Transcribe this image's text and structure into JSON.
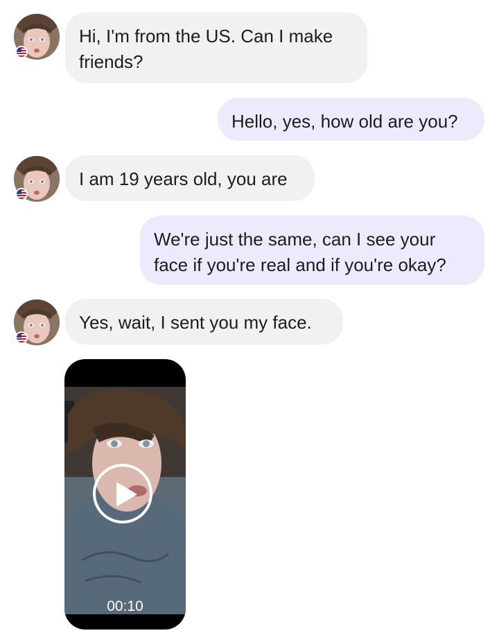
{
  "conversation": {
    "contact_country_flag": "us-flag-icon",
    "messages": [
      {
        "direction": "incoming",
        "text": "Hi, I'm from the US. Can I make friends?"
      },
      {
        "direction": "outgoing",
        "text": "Hello, yes, how old are you?"
      },
      {
        "direction": "incoming",
        "text": "I am 19 years old, you are"
      },
      {
        "direction": "outgoing",
        "text": "We're just the same, can I see your face if you're real and if you're okay?"
      },
      {
        "direction": "incoming",
        "text": "Yes, wait, I sent you my face."
      }
    ],
    "video_message": {
      "duration": "00:10",
      "icon": "play-icon"
    }
  },
  "colors": {
    "incoming_bubble": "#f1f1f1",
    "outgoing_bubble": "#ecebfd",
    "text": "#1c1c1e",
    "video_background": "#000000"
  }
}
